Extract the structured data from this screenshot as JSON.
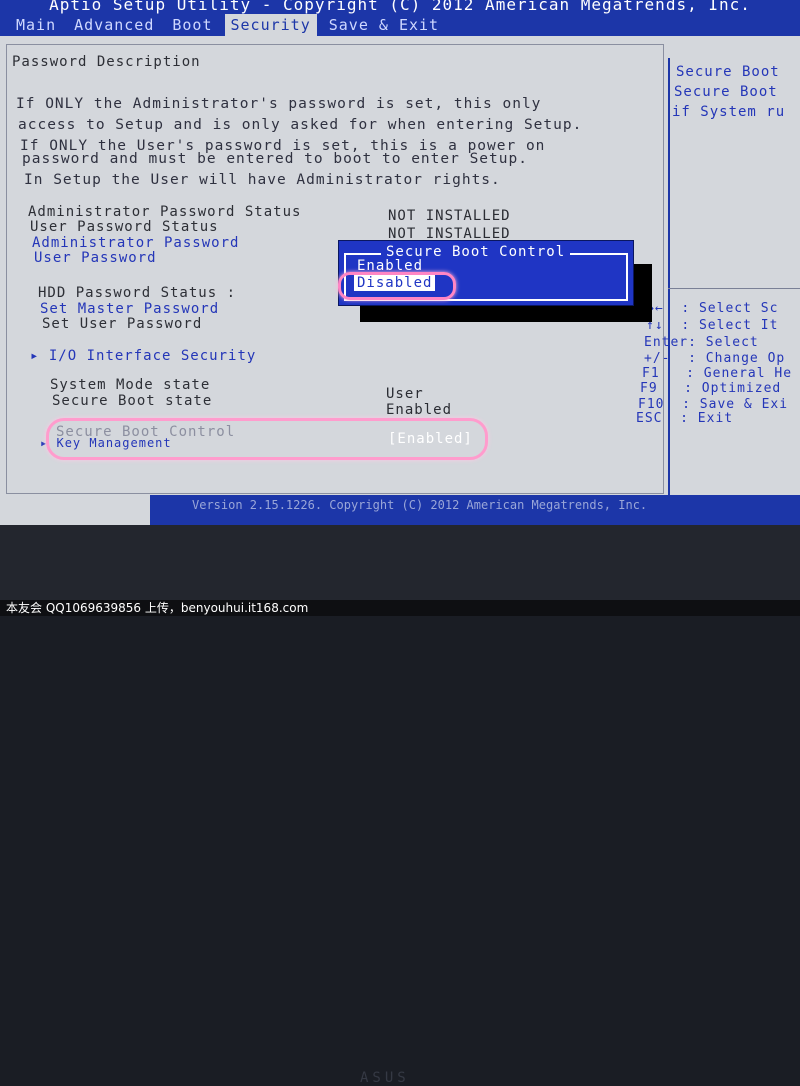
{
  "window": {
    "title": "Aptio Setup Utility - Copyright (C) 2012 American Megatrends, Inc."
  },
  "tabs": [
    {
      "label": "Main"
    },
    {
      "label": "Advanced"
    },
    {
      "label": "Boot"
    },
    {
      "label": "Security",
      "active": true
    },
    {
      "label": "Save & Exit"
    }
  ],
  "description": {
    "heading": "Password Description",
    "lines": [
      "If ONLY the Administrator's password is set, this only",
      "access to Setup and is only asked for when entering Setup.",
      "If ONLY the User's password is set, this is a power on",
      "password and must be entered to boot to enter Setup.",
      "In Setup the User will have Administrator rights."
    ]
  },
  "settings": {
    "admin_status_label": "Administrator Password Status",
    "admin_status_value": "NOT INSTALLED",
    "user_status_label": "User Password Status",
    "user_status_value": "NOT INSTALLED",
    "admin_password": "Administrator Password",
    "user_password": "User Password",
    "hdd_status_label": "HDD Password Status  :",
    "set_master_password": "Set Master Password",
    "set_user_password": "Set User Password",
    "io_interface_security": "I/O Interface Security",
    "system_mode_label": "System Mode state",
    "system_mode_value": "User",
    "secure_boot_state_label": "Secure Boot state",
    "secure_boot_state_value": "Enabled",
    "secure_boot_control_label": "Secure Boot Control",
    "secure_boot_control_value": "[Enabled]",
    "key_management": "Key Management"
  },
  "popup": {
    "title": "Secure Boot Control",
    "options": [
      {
        "label": "Enabled"
      },
      {
        "label": "Disabled",
        "selected": true
      }
    ]
  },
  "help": {
    "lines": [
      "Secure Boot",
      "Secure Boot",
      "if System ru"
    ]
  },
  "keys": [
    {
      "key": "→←",
      "action": ": Select Sc"
    },
    {
      "key": "↑↓",
      "action": ": Select It"
    },
    {
      "key": "Enter",
      "action": ": Select"
    },
    {
      "key": "+/-",
      "action": ": Change Op"
    },
    {
      "key": "F1",
      "action": ": General He"
    },
    {
      "key": "F9",
      "action": ": Optimized"
    },
    {
      "key": "F10",
      "action": ": Save & Exi"
    },
    {
      "key": "ESC",
      "action": ": Exit"
    }
  ],
  "footer": {
    "version": "Version 2.15.1226. Copyright (C) 2012 American Megatrends, Inc."
  },
  "bezel": {
    "brand": "ASUS"
  },
  "caption": {
    "text": "本友会 QQ1069639856 上传，benyouhui.it168.com"
  },
  "colors": {
    "bios_blue": "#1c36a8",
    "bios_grey": "#d4d7dc",
    "link_blue": "#2436b8",
    "highlight_ring": "#ff86c4"
  }
}
